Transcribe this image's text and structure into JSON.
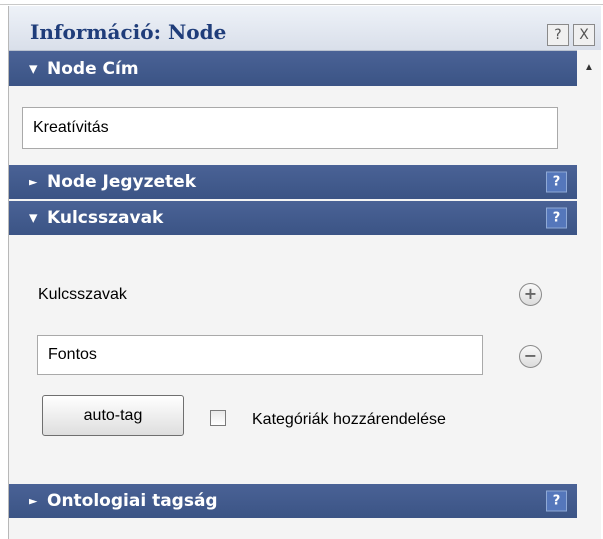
{
  "window": {
    "title": "Információ: Node",
    "help_glyph": "?",
    "close_glyph": "X"
  },
  "sections": {
    "node_cim": {
      "label": "Node Cím",
      "value": "Kreatívitás"
    },
    "node_jegyzetek": {
      "label": "Node Jegyzetek",
      "help": "?"
    },
    "kulcsszavak": {
      "label": "Kulcsszavak",
      "help": "?",
      "field_label": "Kulcsszavak",
      "keyword_value": "Fontos",
      "add_glyph": "+",
      "remove_glyph": "−",
      "autotag_label": "auto-tag",
      "checkbox_label": "Kategóriák hozzárendelése",
      "checkbox_checked": false
    },
    "ontologiai": {
      "label": "Ontologiai tagság",
      "help": "?"
    }
  },
  "icons": {
    "expanded": "▼",
    "collapsed": "►",
    "scroll_up": "▲"
  },
  "colors": {
    "header_bg": "#3f5a8c",
    "title_text": "#1f3d7a",
    "help_badge": "#5577bb"
  }
}
